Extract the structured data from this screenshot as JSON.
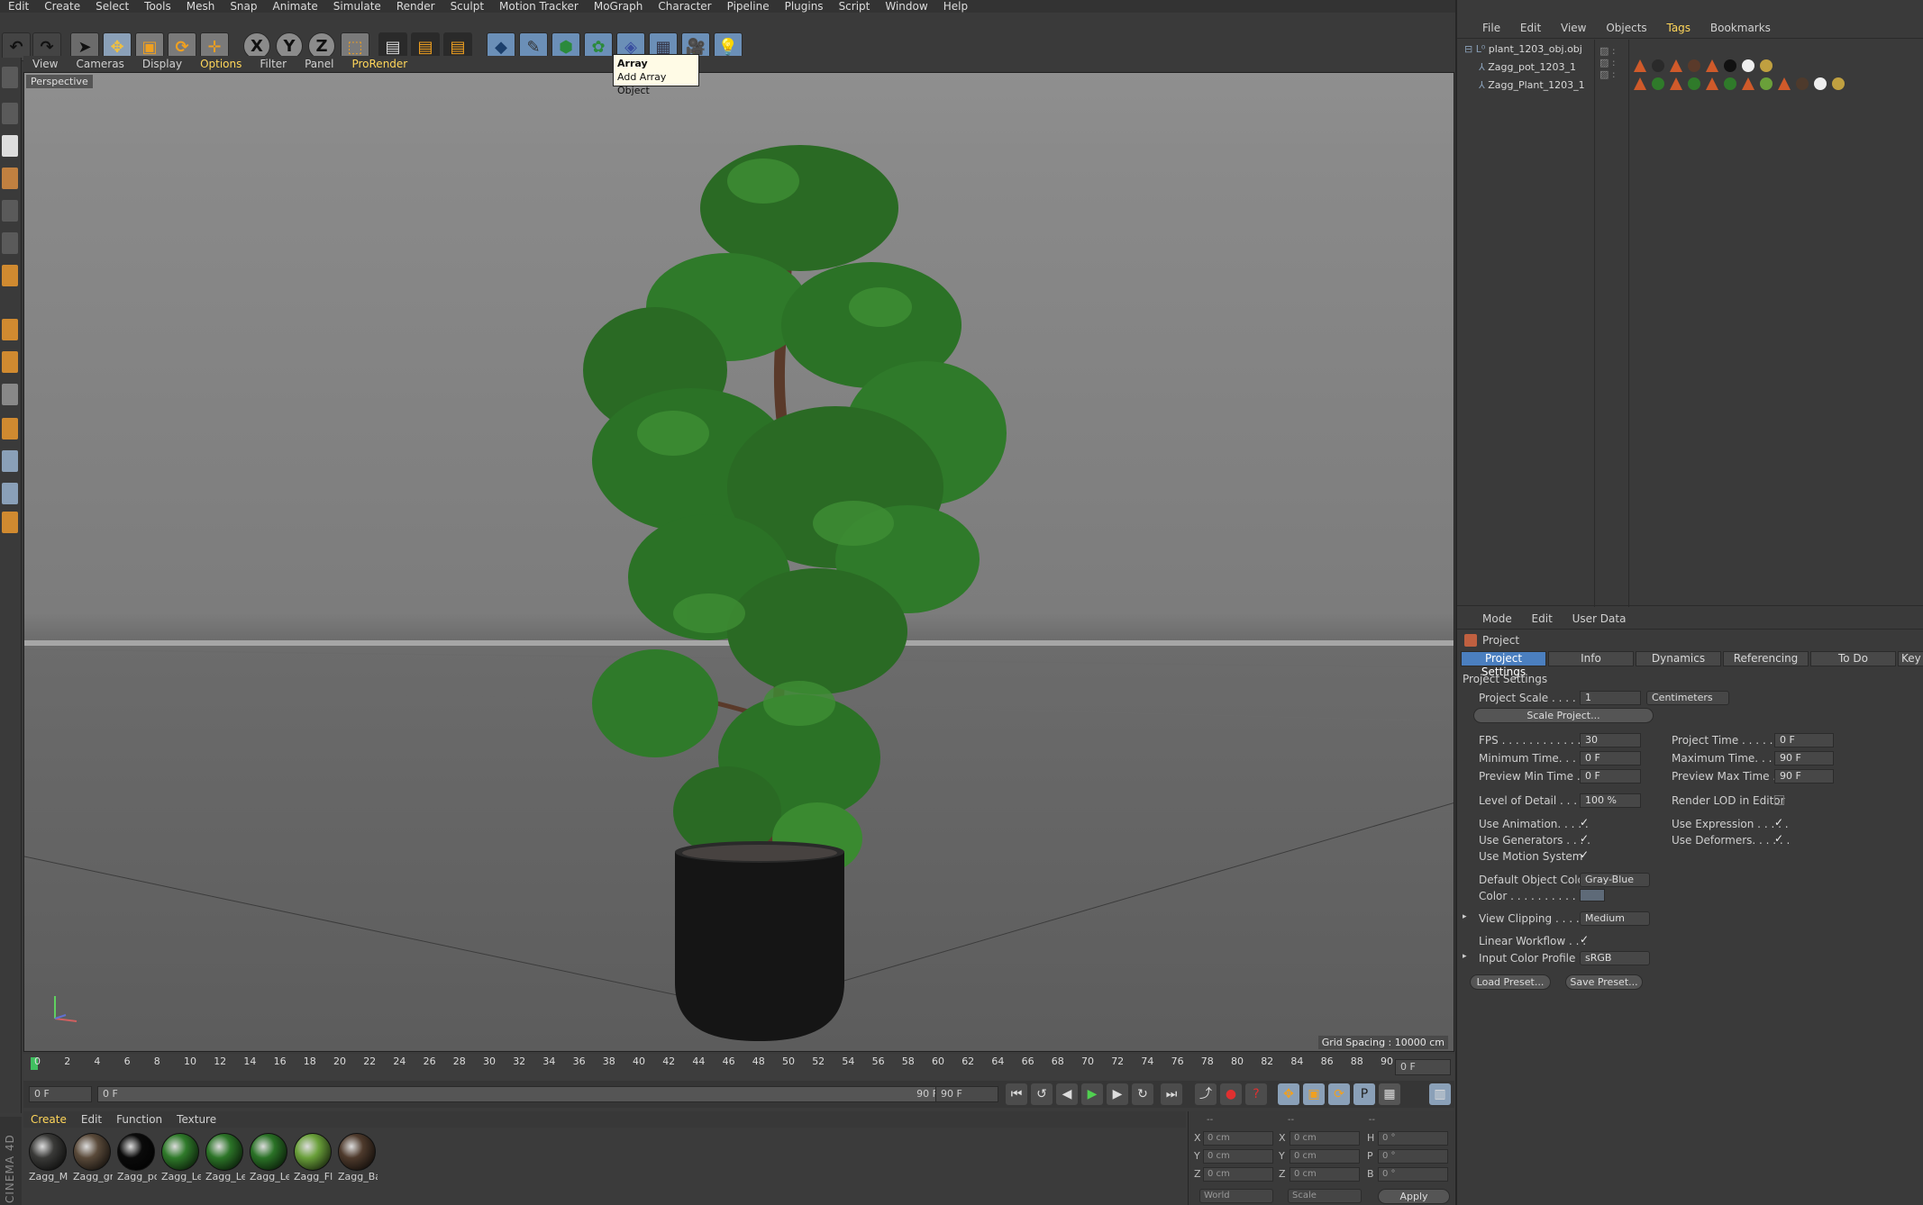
{
  "menubar": [
    "Edit",
    "Create",
    "Select",
    "Tools",
    "Mesh",
    "Snap",
    "Animate",
    "Simulate",
    "Render",
    "Sculpt",
    "Motion Tracker",
    "MoGraph",
    "Character",
    "Pipeline",
    "Plugins",
    "Script",
    "Window",
    "Help"
  ],
  "tooltip": {
    "title": "Array",
    "desc": "Add Array Object"
  },
  "viewport": {
    "menu": [
      "View",
      "Cameras",
      "Display",
      "Options",
      "Filter",
      "Panel",
      "ProRender"
    ],
    "label": "Perspective",
    "grid_spacing": "Grid Spacing : 10000 cm"
  },
  "timeline": {
    "ticks": [
      "0",
      "2",
      "4",
      "6",
      "8",
      "10",
      "12",
      "14",
      "16",
      "18",
      "20",
      "22",
      "24",
      "26",
      "28",
      "30",
      "32",
      "34",
      "36",
      "38",
      "40",
      "42",
      "44",
      "46",
      "48",
      "50",
      "52",
      "54",
      "56",
      "58",
      "60",
      "62",
      "64",
      "66",
      "68",
      "70",
      "72",
      "74",
      "76",
      "78",
      "80",
      "82",
      "84",
      "86",
      "88",
      "90"
    ],
    "current": "0 F",
    "start": "0 F",
    "range_start": "0 F",
    "range_end": "90 F",
    "end": "90 F"
  },
  "materials": {
    "menu": [
      "Create",
      "Edit",
      "Function",
      "Texture"
    ],
    "items": [
      {
        "name": "Zagg_M",
        "color": "#3a3a38"
      },
      {
        "name": "Zagg_gr",
        "color": "#5a4a3a"
      },
      {
        "name": "Zagg_po",
        "color": "#0a0a0a"
      },
      {
        "name": "Zagg_Le",
        "color": "#2f7a2a"
      },
      {
        "name": "Zagg_Le",
        "color": "#2c7528"
      },
      {
        "name": "Zagg_Le",
        "color": "#2a7226"
      },
      {
        "name": "Zagg_Fl",
        "color": "#6aa03a"
      },
      {
        "name": "Zagg_Ba",
        "color": "#4e3a2c"
      }
    ]
  },
  "coords": {
    "rows": [
      {
        "a": "X",
        "av": "0 cm",
        "b": "X",
        "bv": "0 cm",
        "c": "H",
        "cv": "0 °"
      },
      {
        "a": "Y",
        "av": "0 cm",
        "b": "Y",
        "bv": "0 cm",
        "c": "P",
        "cv": "0 °"
      },
      {
        "a": "Z",
        "av": "0 cm",
        "b": "Z",
        "bv": "0 cm",
        "c": "B",
        "cv": "0 °"
      }
    ],
    "world": "World",
    "scale": "Scale",
    "apply": "Apply"
  },
  "objects": {
    "menu": [
      "File",
      "Edit",
      "View",
      "Objects",
      "Tags",
      "Bookmarks"
    ],
    "items": [
      "plant_1203_obj.obj",
      "Zagg_pot_1203_1",
      "Zagg_Plant_1203_1"
    ]
  },
  "attributes": {
    "menu": [
      "Mode",
      "Edit",
      "User Data"
    ],
    "title": "Project",
    "tabs": [
      "Project Settings",
      "Info",
      "Dynamics",
      "Referencing",
      "To Do",
      "Key In"
    ],
    "section": "Project Settings",
    "project_scale_label": "Project Scale . . . . . .",
    "project_scale": "1",
    "scale_unit": "Centimeters",
    "scale_project_btn": "Scale Project...",
    "fps_label": "FPS . . . . . . . . . . . . .",
    "fps": "30",
    "project_time_label": "Project Time . . . . . . .",
    "project_time": "0 F",
    "min_time_label": "Minimum Time. . . . .",
    "min_time": "0 F",
    "max_time_label": "Maximum Time. . . . . .",
    "max_time": "90 F",
    "prev_min_label": "Preview Min Time . .",
    "prev_min": "0 F",
    "prev_max_label": "Preview Max Time . .",
    "prev_max": "90 F",
    "lod_label": "Level of Detail . . . . .",
    "lod": "100 %",
    "render_lod_label": "Render LOD in Editor",
    "use_anim": "Use Animation. . . . .",
    "use_expr": "Use Expression . . . . .",
    "use_gen": "Use Generators . . . .",
    "use_def": "Use Deformers. . . . . .",
    "use_motion": "Use Motion System",
    "default_color_label": "Default Object Color",
    "default_color": "Gray-Blue",
    "color_label": "Color . . . . . . . . . . .",
    "view_clip_label": "View Clipping . . . . .",
    "view_clip": "Medium",
    "linear_wf": "Linear Workflow . . .",
    "input_profile_label": "Input Color Profile . .",
    "input_profile": "sRGB",
    "load_preset": "Load Preset...",
    "save_preset": "Save Preset..."
  },
  "brand": "CINEMA 4D"
}
